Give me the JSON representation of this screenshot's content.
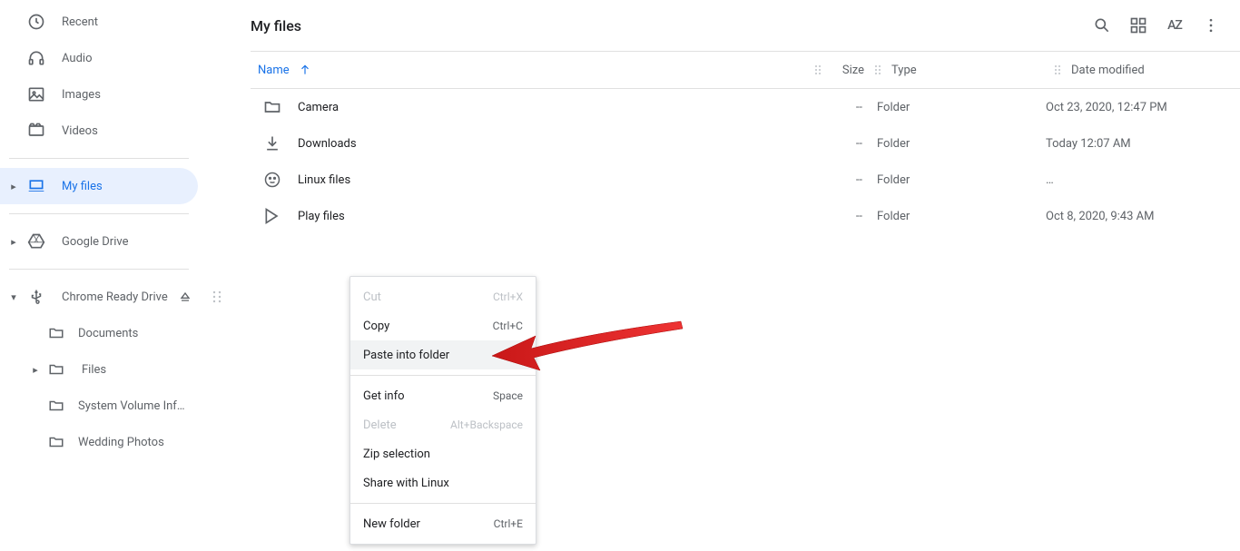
{
  "sidebar": {
    "items": [
      {
        "icon": "clock",
        "label": "Recent"
      },
      {
        "icon": "headphones",
        "label": "Audio"
      },
      {
        "icon": "image",
        "label": "Images"
      },
      {
        "icon": "video",
        "label": "Videos"
      }
    ],
    "myfiles_label": "My files",
    "gdrive_label": "Google Drive",
    "usb_label": "Chrome Ready Drive",
    "usb_children": [
      {
        "label": "Documents"
      },
      {
        "label": "Files",
        "expandable": true
      },
      {
        "label": "System Volume Inf…"
      },
      {
        "label": "Wedding Photos"
      }
    ]
  },
  "header": {
    "title": "My files"
  },
  "columns": {
    "name": "Name",
    "size": "Size",
    "type": "Type",
    "date": "Date modified"
  },
  "files": [
    {
      "icon": "folder",
      "name": "Camera",
      "size": "--",
      "type": "Folder",
      "date": "Oct 23, 2020, 12:47 PM"
    },
    {
      "icon": "download",
      "name": "Downloads",
      "size": "--",
      "type": "Folder",
      "date": "Today 12:07 AM"
    },
    {
      "icon": "linux",
      "name": "Linux files",
      "size": "--",
      "type": "Folder",
      "date": "…"
    },
    {
      "icon": "play",
      "name": "Play files",
      "size": "--",
      "type": "Folder",
      "date": "Oct 8, 2020, 9:43 AM"
    }
  ],
  "context_menu": {
    "cut": {
      "label": "Cut",
      "shortcut": "Ctrl+X"
    },
    "copy": {
      "label": "Copy",
      "shortcut": "Ctrl+C"
    },
    "paste": {
      "label": "Paste into folder"
    },
    "getinfo": {
      "label": "Get info",
      "shortcut": "Space"
    },
    "delete": {
      "label": "Delete",
      "shortcut": "Alt+Backspace"
    },
    "zip": {
      "label": "Zip selection"
    },
    "share": {
      "label": "Share with Linux"
    },
    "newfolder": {
      "label": "New folder",
      "shortcut": "Ctrl+E"
    }
  }
}
